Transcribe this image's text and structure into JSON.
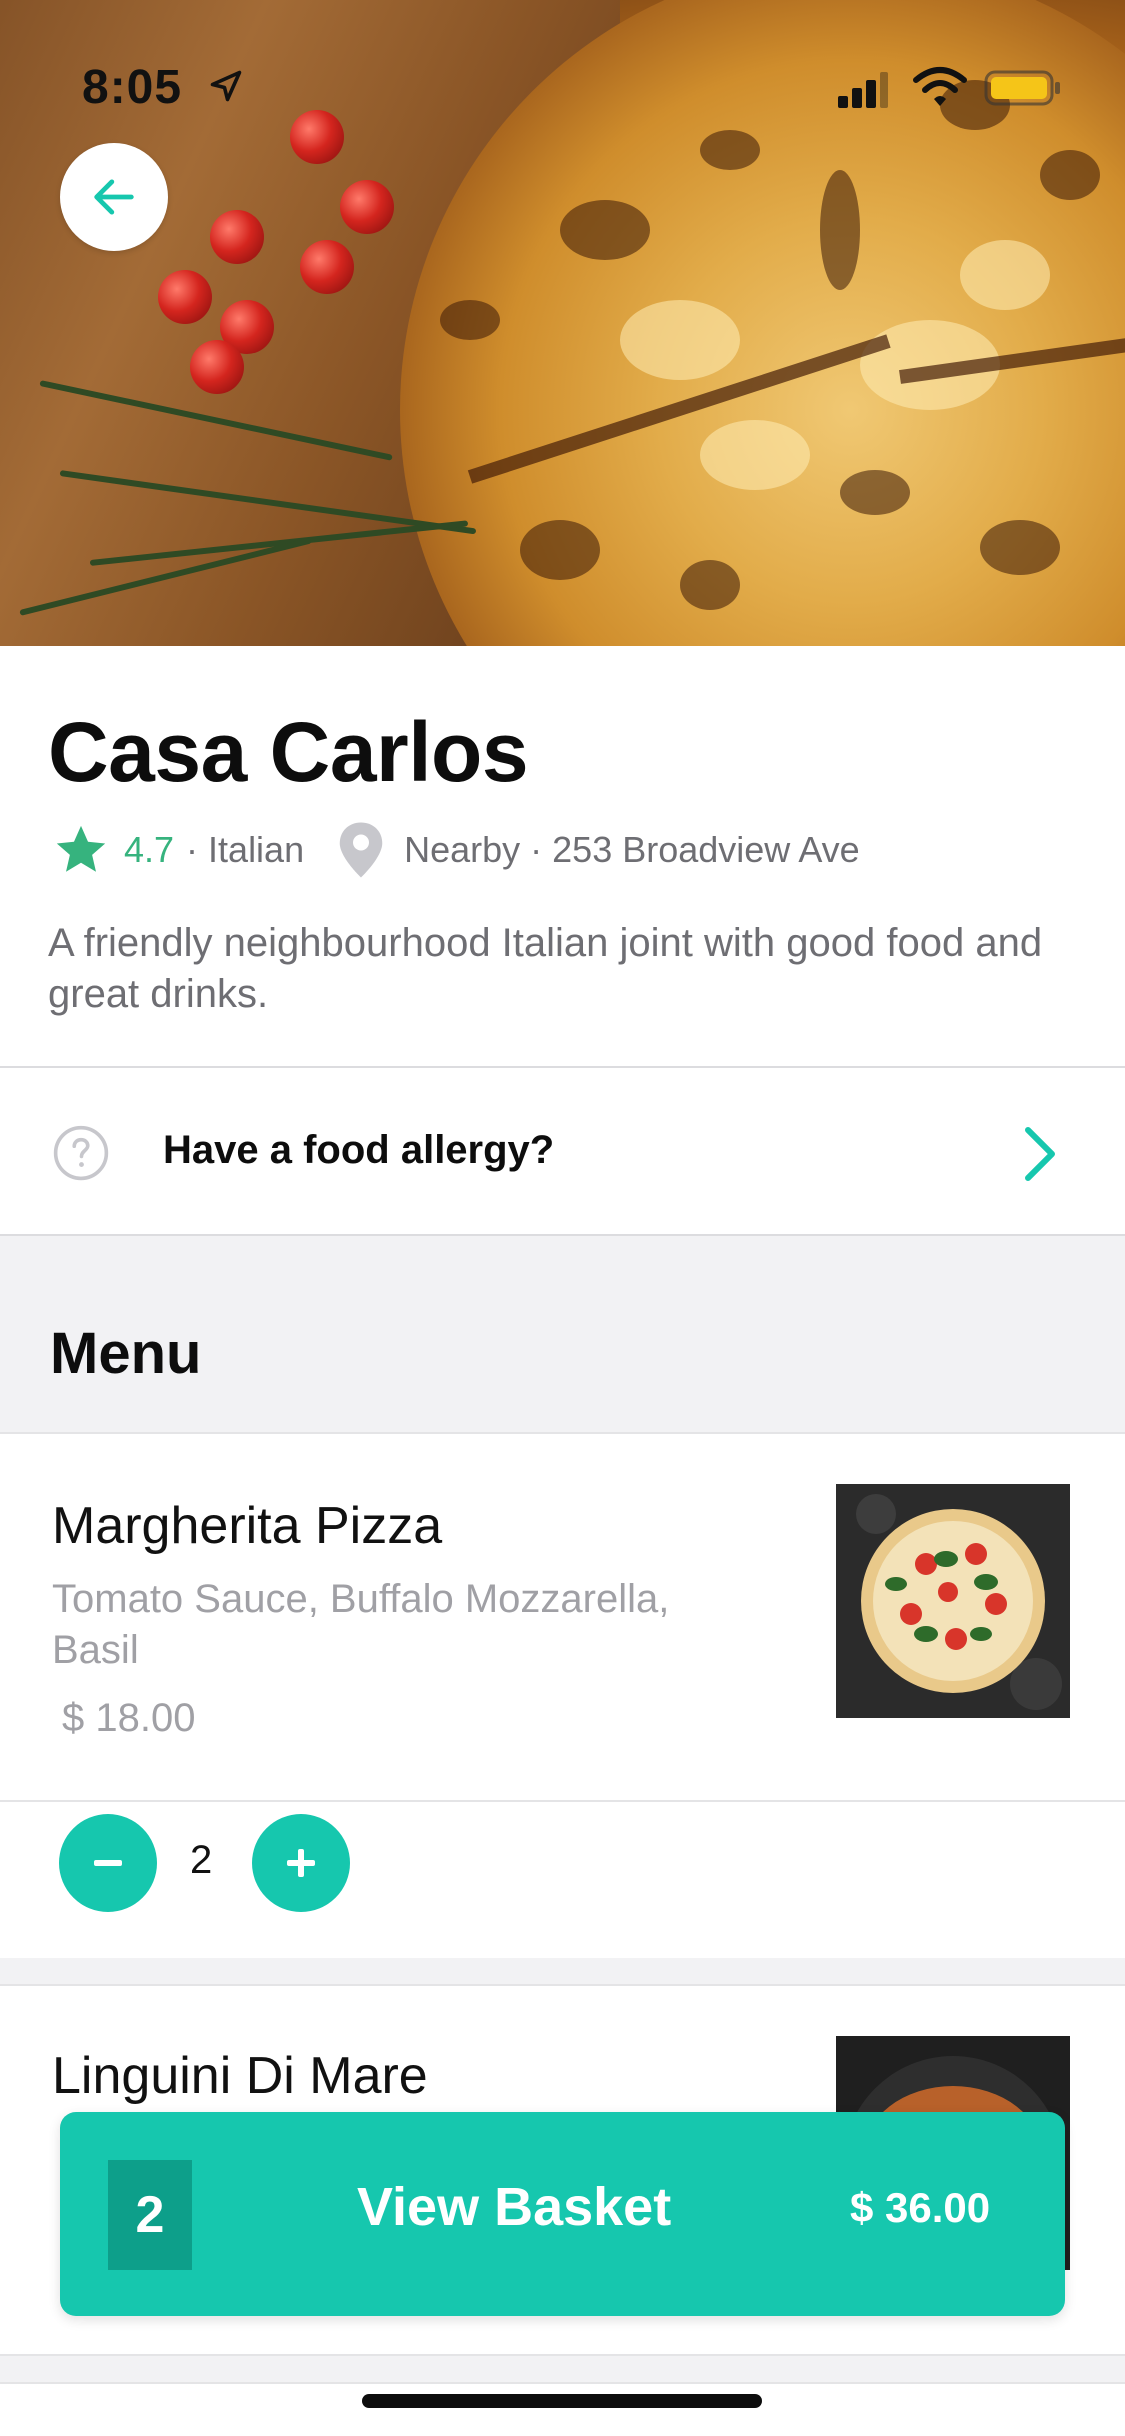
{
  "status_bar": {
    "time": "8:05"
  },
  "restaurant": {
    "name": "Casa Carlos",
    "rating": "4.7",
    "cuisine": "· Italian",
    "location": "Nearby · 253 Broadview Ave",
    "description": "A friendly neighbourhood Italian joint with good food and great drinks."
  },
  "allergy": {
    "label": "Have a food allergy?"
  },
  "menu": {
    "title": "Menu",
    "items": [
      {
        "name": "Margherita Pizza",
        "description": "Tomato Sauce, Buffalo Mozzarella, Basil",
        "price": "$ 18.00",
        "quantity": "2"
      },
      {
        "name": "Linguini Di Mare"
      }
    ]
  },
  "basket": {
    "count": "2",
    "label": "View Basket",
    "total": "$ 36.00"
  },
  "colors": {
    "accent": "#16c7ae",
    "rating": "#36b37e",
    "muted": "#6e6e73"
  }
}
